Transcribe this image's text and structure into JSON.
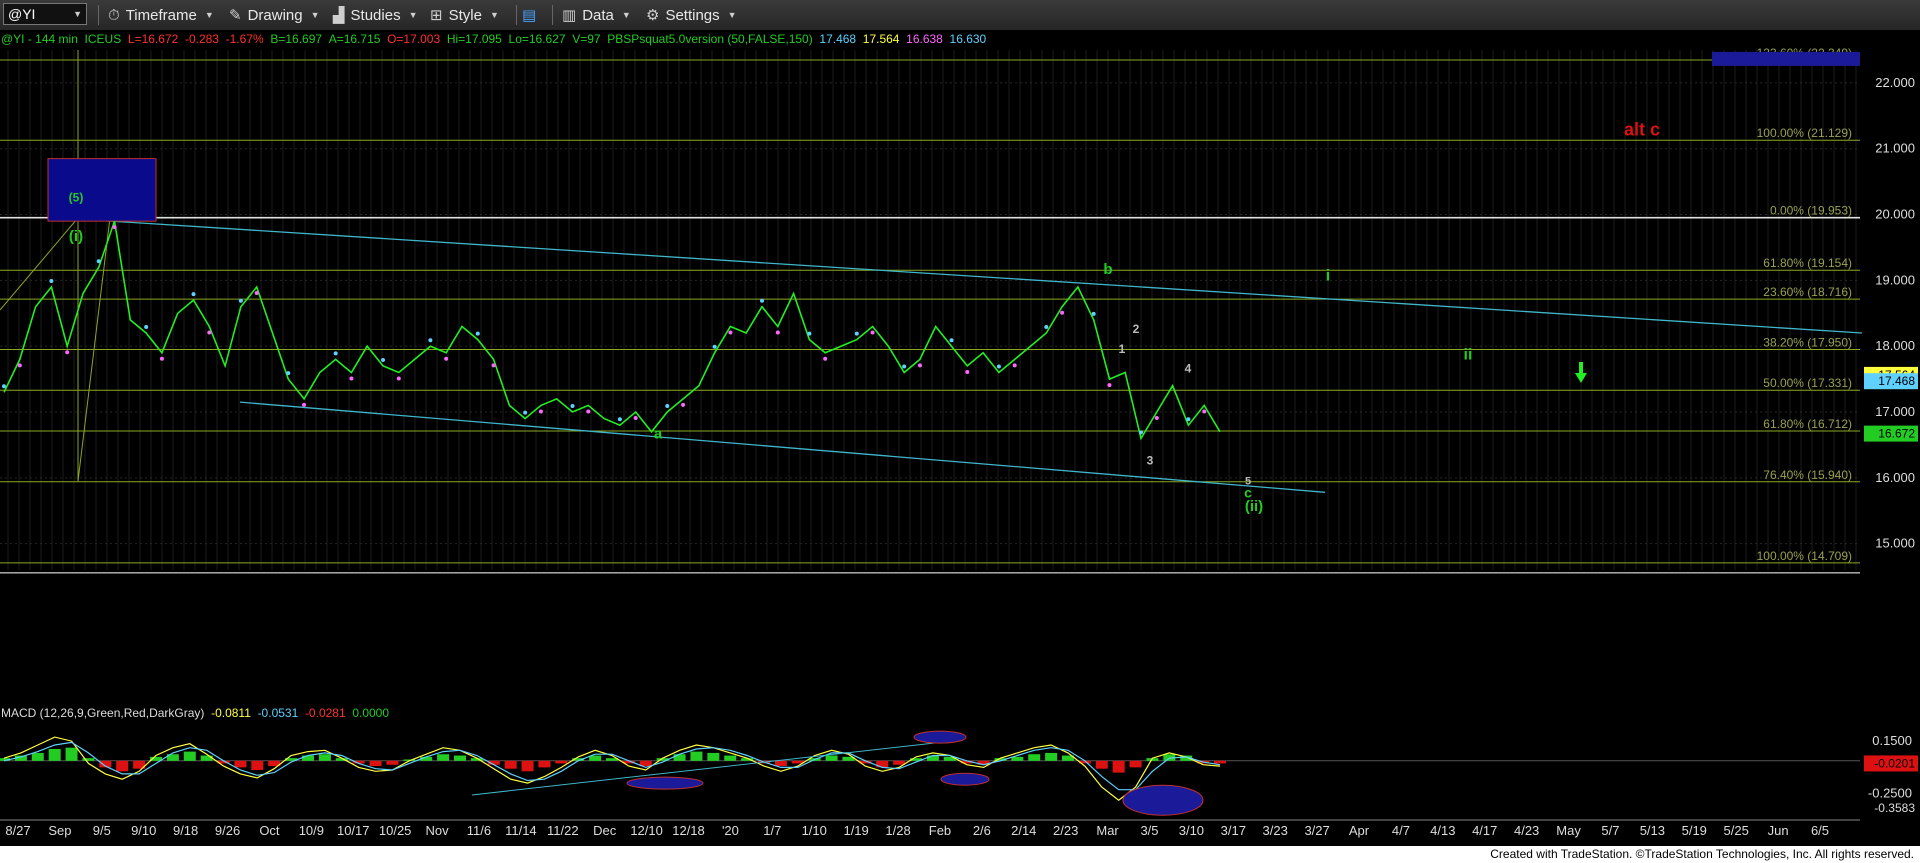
{
  "toolbar": {
    "symbol": "@YI",
    "items": [
      {
        "label": "Timeframe",
        "icon": "timeframe-icon"
      },
      {
        "label": "Drawing",
        "icon": "drawing-icon"
      },
      {
        "label": "Studies",
        "icon": "studies-icon"
      },
      {
        "label": "Style",
        "icon": "style-icon"
      },
      {
        "label": "Data",
        "icon": "data-icon"
      },
      {
        "label": "Settings",
        "icon": "gear-icon"
      }
    ]
  },
  "header": {
    "parts": [
      {
        "text": "@YI - 144 min  ICEUS  ",
        "color": "#22cc22"
      },
      {
        "text": "L=16.672  -0.283  -1.67%  ",
        "color": "#ff3030"
      },
      {
        "text": "B=16.697  A=16.715  ",
        "color": "#22cc22"
      },
      {
        "text": "O=17.003  ",
        "color": "#ff3030"
      },
      {
        "text": "Hi=17.095  Lo=16.627  V=97  PBSPsquat5.0version (50,FALSE,150)  ",
        "color": "#22cc22"
      },
      {
        "text": "17.468  ",
        "color": "#5fd0ff"
      },
      {
        "text": "17.564  ",
        "color": "#ffff40"
      },
      {
        "text": "16.638  ",
        "color": "#ff66ff"
      },
      {
        "text": "16.630",
        "color": "#5fd0ff"
      }
    ]
  },
  "macd_header": {
    "parts": [
      {
        "text": "MACD (12,26,9,Green,Red,DarkGray)  ",
        "color": "#dddddd"
      },
      {
        "text": "-0.0811  ",
        "color": "#ffff40"
      },
      {
        "text": "-0.0531  ",
        "color": "#5fd0ff"
      },
      {
        "text": "-0.0281  ",
        "color": "#ff3030"
      },
      {
        "text": "0.0000",
        "color": "#22cc22"
      }
    ]
  },
  "footer": "Created with TradeStation. ©TradeStation Technologies, Inc. All rights reserved.",
  "colors": {
    "price": "#22ee22",
    "trendline": "#3fb6c9",
    "fib": "#8aa820",
    "fib_text": "#9aa050",
    "wave_green": "#22cc22",
    "wave_red": "#dd1111",
    "last_price_bg": "#22cc22"
  },
  "chart_data": {
    "type": "line",
    "title": "@YI - 144 min",
    "x": [
      "8/27",
      "Sep",
      "9/5",
      "9/10",
      "9/18",
      "9/26",
      "Oct",
      "10/9",
      "10/17",
      "10/25",
      "Nov",
      "11/6",
      "11/14",
      "11/22",
      "Dec",
      "12/10",
      "12/18",
      "'20",
      "1/7",
      "1/10",
      "1/19",
      "1/28",
      "Feb",
      "2/6",
      "2/14",
      "2/23",
      "Mar",
      "3/5",
      "3/10",
      "3/17",
      "3/23",
      "3/27",
      "Apr",
      "4/7",
      "4/13",
      "4/17",
      "4/23",
      "May",
      "5/7",
      "5/13",
      "5/19",
      "5/25",
      "Jun",
      "6/5"
    ],
    "ylim": [
      14.6,
      22.5
    ],
    "yticks": [
      15.0,
      16.0,
      17.0,
      18.0,
      19.0,
      20.0,
      21.0,
      22.0
    ],
    "series": [
      {
        "values": [
          17.3,
          17.8,
          18.6,
          18.9,
          18.0,
          18.8,
          19.2,
          19.9,
          18.4,
          18.2,
          17.9,
          18.5,
          18.7,
          18.3,
          17.7,
          18.6,
          18.9,
          18.2,
          17.5,
          17.2,
          17.6,
          17.8,
          17.6,
          18.0,
          17.7,
          17.6,
          17.8,
          18.0,
          17.9,
          18.3,
          18.1,
          17.8,
          17.1,
          16.9,
          17.1,
          17.2,
          17.0,
          17.1,
          16.9,
          16.8,
          17.0,
          16.7,
          17.0,
          17.2,
          17.4,
          17.9,
          18.3,
          18.2,
          18.6,
          18.3,
          18.8,
          18.1,
          17.9,
          18.0,
          18.1,
          18.3,
          18.0,
          17.6,
          17.8,
          18.3,
          18.0,
          17.7,
          17.9,
          17.6,
          17.8,
          18.0,
          18.2,
          18.6,
          18.9,
          18.4,
          17.5,
          17.6,
          16.6,
          17.0,
          17.4,
          16.8,
          17.1,
          16.7
        ]
      }
    ],
    "fib_levels": [
      {
        "label": "123.60% (22.349)",
        "value": 22.349
      },
      {
        "label": "100.00% (21.129)",
        "value": 21.129
      },
      {
        "label": "0.00% (19.953)",
        "value": 19.953
      },
      {
        "label": "61.80% (19.154)",
        "value": 19.154
      },
      {
        "label": "23.60% (18.716)",
        "value": 18.716
      },
      {
        "label": "38.20% (17.950)",
        "value": 17.95
      },
      {
        "label": "50.00% (17.331)",
        "value": 17.331
      },
      {
        "label": "61.80% (16.712)",
        "value": 16.712
      },
      {
        "label": "76.40% (15.940)",
        "value": 15.94
      },
      {
        "label": "100.00% (14.709)",
        "value": 14.709
      }
    ],
    "wave_labels": [
      {
        "text": "(i)",
        "value": 19.6,
        "color": "green"
      },
      {
        "text": "(5)",
        "value": 20.2,
        "color": "green"
      },
      {
        "text": "a",
        "value": 16.6,
        "color": "green"
      },
      {
        "text": "b",
        "value": 19.1,
        "color": "green"
      },
      {
        "text": "1",
        "value": 17.9,
        "color": "white"
      },
      {
        "text": "2",
        "value": 18.2,
        "color": "white"
      },
      {
        "text": "3",
        "value": 16.2,
        "color": "white"
      },
      {
        "text": "4",
        "value": 17.6,
        "color": "white"
      },
      {
        "text": "5",
        "value": 15.9,
        "color": "white"
      },
      {
        "text": "c",
        "value": 15.7,
        "color": "green"
      },
      {
        "text": "(ii)",
        "value": 15.5,
        "color": "green"
      },
      {
        "text": "i",
        "value": 19.0,
        "color": "green"
      },
      {
        "text": "ii",
        "value": 17.8,
        "color": "green"
      },
      {
        "text": "alt c",
        "value": 21.2,
        "color": "red"
      }
    ],
    "price_badges": [
      {
        "text": "17.564",
        "color": "#ffff40"
      },
      {
        "text": "17.468",
        "color": "#5fd0ff"
      },
      {
        "text": "16.672",
        "color": "#22cc22"
      }
    ],
    "macd": {
      "ylim": [
        -0.42,
        0.28
      ],
      "yticks": [
        {
          "label": "0.1500",
          "value": 0.15
        },
        {
          "label": "-0.2500",
          "value": -0.25
        }
      ],
      "badges": [
        {
          "text": "-0.0201",
          "value": -0.0201,
          "color": "#dd1111"
        },
        {
          "text": "-0.3583",
          "value": -0.3583,
          "color": "#000000"
        }
      ],
      "histogram": [
        0.02,
        0.04,
        0.06,
        0.09,
        0.1,
        0.02,
        -0.05,
        -0.08,
        -0.06,
        0.03,
        0.05,
        0.07,
        0.04,
        -0.02,
        -0.05,
        -0.07,
        -0.04,
        0.02,
        0.04,
        0.05,
        0.02,
        -0.02,
        -0.04,
        -0.03,
        0.01,
        0.03,
        0.05,
        0.04,
        0.02,
        -0.03,
        -0.06,
        -0.08,
        -0.05,
        -0.02,
        0.02,
        0.04,
        0.02,
        -0.02,
        -0.04,
        0.02,
        0.05,
        0.07,
        0.06,
        0.04,
        0.02,
        -0.02,
        -0.04,
        -0.02,
        0.02,
        0.04,
        0.03,
        -0.02,
        -0.05,
        -0.03,
        0.02,
        0.04,
        0.03,
        -0.02,
        -0.03,
        0.02,
        0.03,
        0.05,
        0.06,
        0.04,
        -0.02,
        -0.06,
        -0.09,
        -0.05,
        0.02,
        0.05,
        0.04,
        -0.02,
        -0.02
      ],
      "macd_line": [
        0.02,
        0.06,
        0.12,
        0.18,
        0.15,
        -0.02,
        -0.1,
        -0.14,
        -0.08,
        0.04,
        0.1,
        0.13,
        0.05,
        -0.04,
        -0.1,
        -0.13,
        -0.06,
        0.04,
        0.07,
        0.08,
        0.02,
        -0.05,
        -0.08,
        -0.07,
        0.0,
        0.05,
        0.1,
        0.08,
        0.02,
        -0.06,
        -0.14,
        -0.17,
        -0.12,
        -0.05,
        0.03,
        0.08,
        0.04,
        -0.04,
        -0.07,
        0.02,
        0.08,
        0.12,
        0.1,
        0.06,
        0.02,
        -0.04,
        -0.08,
        -0.04,
        0.04,
        0.08,
        0.05,
        -0.04,
        -0.08,
        -0.05,
        0.03,
        0.06,
        0.04,
        -0.03,
        -0.05,
        0.02,
        0.06,
        0.1,
        0.12,
        0.06,
        -0.04,
        -0.2,
        -0.3,
        -0.2,
        0.02,
        0.06,
        0.03,
        -0.03,
        -0.04
      ],
      "signal_line": [
        0.0,
        0.03,
        0.07,
        0.12,
        0.14,
        0.06,
        -0.04,
        -0.1,
        -0.1,
        -0.02,
        0.06,
        0.1,
        0.08,
        0.0,
        -0.07,
        -0.11,
        -0.09,
        -0.01,
        0.04,
        0.06,
        0.04,
        -0.02,
        -0.06,
        -0.07,
        -0.02,
        0.03,
        0.07,
        0.08,
        0.04,
        -0.03,
        -0.1,
        -0.15,
        -0.14,
        -0.08,
        0.0,
        0.05,
        0.05,
        0.0,
        -0.05,
        -0.01,
        0.05,
        0.09,
        0.1,
        0.08,
        0.04,
        -0.01,
        -0.05,
        -0.05,
        0.01,
        0.06,
        0.06,
        0.0,
        -0.05,
        -0.06,
        -0.01,
        0.04,
        0.04,
        0.0,
        -0.03,
        0.0,
        0.04,
        0.08,
        0.1,
        0.08,
        0.0,
        -0.12,
        -0.22,
        -0.22,
        -0.08,
        0.02,
        0.03,
        -0.01,
        -0.03
      ]
    }
  }
}
